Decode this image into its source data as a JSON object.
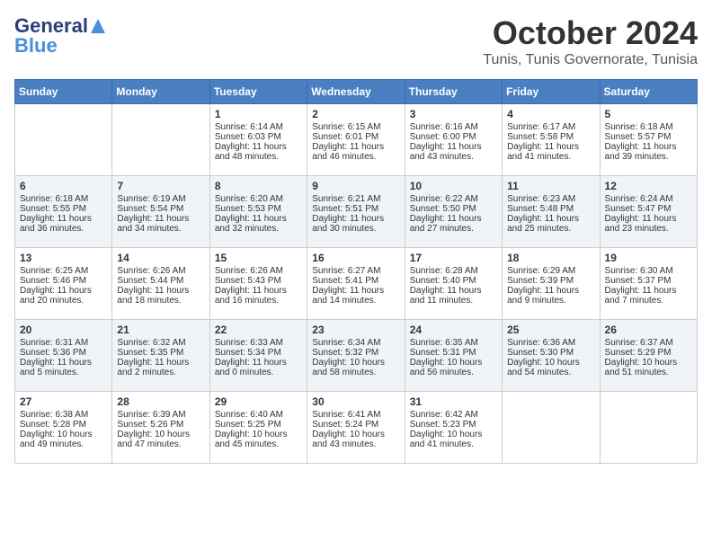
{
  "header": {
    "logo_line1": "General",
    "logo_line2": "Blue",
    "month": "October 2024",
    "location": "Tunis, Tunis Governorate, Tunisia"
  },
  "days_of_week": [
    "Sunday",
    "Monday",
    "Tuesday",
    "Wednesday",
    "Thursday",
    "Friday",
    "Saturday"
  ],
  "weeks": [
    [
      {
        "day": "",
        "sunrise": "",
        "sunset": "",
        "daylight": ""
      },
      {
        "day": "",
        "sunrise": "",
        "sunset": "",
        "daylight": ""
      },
      {
        "day": "1",
        "sunrise": "Sunrise: 6:14 AM",
        "sunset": "Sunset: 6:03 PM",
        "daylight": "Daylight: 11 hours and 48 minutes."
      },
      {
        "day": "2",
        "sunrise": "Sunrise: 6:15 AM",
        "sunset": "Sunset: 6:01 PM",
        "daylight": "Daylight: 11 hours and 46 minutes."
      },
      {
        "day": "3",
        "sunrise": "Sunrise: 6:16 AM",
        "sunset": "Sunset: 6:00 PM",
        "daylight": "Daylight: 11 hours and 43 minutes."
      },
      {
        "day": "4",
        "sunrise": "Sunrise: 6:17 AM",
        "sunset": "Sunset: 5:58 PM",
        "daylight": "Daylight: 11 hours and 41 minutes."
      },
      {
        "day": "5",
        "sunrise": "Sunrise: 6:18 AM",
        "sunset": "Sunset: 5:57 PM",
        "daylight": "Daylight: 11 hours and 39 minutes."
      }
    ],
    [
      {
        "day": "6",
        "sunrise": "Sunrise: 6:18 AM",
        "sunset": "Sunset: 5:55 PM",
        "daylight": "Daylight: 11 hours and 36 minutes."
      },
      {
        "day": "7",
        "sunrise": "Sunrise: 6:19 AM",
        "sunset": "Sunset: 5:54 PM",
        "daylight": "Daylight: 11 hours and 34 minutes."
      },
      {
        "day": "8",
        "sunrise": "Sunrise: 6:20 AM",
        "sunset": "Sunset: 5:53 PM",
        "daylight": "Daylight: 11 hours and 32 minutes."
      },
      {
        "day": "9",
        "sunrise": "Sunrise: 6:21 AM",
        "sunset": "Sunset: 5:51 PM",
        "daylight": "Daylight: 11 hours and 30 minutes."
      },
      {
        "day": "10",
        "sunrise": "Sunrise: 6:22 AM",
        "sunset": "Sunset: 5:50 PM",
        "daylight": "Daylight: 11 hours and 27 minutes."
      },
      {
        "day": "11",
        "sunrise": "Sunrise: 6:23 AM",
        "sunset": "Sunset: 5:48 PM",
        "daylight": "Daylight: 11 hours and 25 minutes."
      },
      {
        "day": "12",
        "sunrise": "Sunrise: 6:24 AM",
        "sunset": "Sunset: 5:47 PM",
        "daylight": "Daylight: 11 hours and 23 minutes."
      }
    ],
    [
      {
        "day": "13",
        "sunrise": "Sunrise: 6:25 AM",
        "sunset": "Sunset: 5:46 PM",
        "daylight": "Daylight: 11 hours and 20 minutes."
      },
      {
        "day": "14",
        "sunrise": "Sunrise: 6:26 AM",
        "sunset": "Sunset: 5:44 PM",
        "daylight": "Daylight: 11 hours and 18 minutes."
      },
      {
        "day": "15",
        "sunrise": "Sunrise: 6:26 AM",
        "sunset": "Sunset: 5:43 PM",
        "daylight": "Daylight: 11 hours and 16 minutes."
      },
      {
        "day": "16",
        "sunrise": "Sunrise: 6:27 AM",
        "sunset": "Sunset: 5:41 PM",
        "daylight": "Daylight: 11 hours and 14 minutes."
      },
      {
        "day": "17",
        "sunrise": "Sunrise: 6:28 AM",
        "sunset": "Sunset: 5:40 PM",
        "daylight": "Daylight: 11 hours and 11 minutes."
      },
      {
        "day": "18",
        "sunrise": "Sunrise: 6:29 AM",
        "sunset": "Sunset: 5:39 PM",
        "daylight": "Daylight: 11 hours and 9 minutes."
      },
      {
        "day": "19",
        "sunrise": "Sunrise: 6:30 AM",
        "sunset": "Sunset: 5:37 PM",
        "daylight": "Daylight: 11 hours and 7 minutes."
      }
    ],
    [
      {
        "day": "20",
        "sunrise": "Sunrise: 6:31 AM",
        "sunset": "Sunset: 5:36 PM",
        "daylight": "Daylight: 11 hours and 5 minutes."
      },
      {
        "day": "21",
        "sunrise": "Sunrise: 6:32 AM",
        "sunset": "Sunset: 5:35 PM",
        "daylight": "Daylight: 11 hours and 2 minutes."
      },
      {
        "day": "22",
        "sunrise": "Sunrise: 6:33 AM",
        "sunset": "Sunset: 5:34 PM",
        "daylight": "Daylight: 11 hours and 0 minutes."
      },
      {
        "day": "23",
        "sunrise": "Sunrise: 6:34 AM",
        "sunset": "Sunset: 5:32 PM",
        "daylight": "Daylight: 10 hours and 58 minutes."
      },
      {
        "day": "24",
        "sunrise": "Sunrise: 6:35 AM",
        "sunset": "Sunset: 5:31 PM",
        "daylight": "Daylight: 10 hours and 56 minutes."
      },
      {
        "day": "25",
        "sunrise": "Sunrise: 6:36 AM",
        "sunset": "Sunset: 5:30 PM",
        "daylight": "Daylight: 10 hours and 54 minutes."
      },
      {
        "day": "26",
        "sunrise": "Sunrise: 6:37 AM",
        "sunset": "Sunset: 5:29 PM",
        "daylight": "Daylight: 10 hours and 51 minutes."
      }
    ],
    [
      {
        "day": "27",
        "sunrise": "Sunrise: 6:38 AM",
        "sunset": "Sunset: 5:28 PM",
        "daylight": "Daylight: 10 hours and 49 minutes."
      },
      {
        "day": "28",
        "sunrise": "Sunrise: 6:39 AM",
        "sunset": "Sunset: 5:26 PM",
        "daylight": "Daylight: 10 hours and 47 minutes."
      },
      {
        "day": "29",
        "sunrise": "Sunrise: 6:40 AM",
        "sunset": "Sunset: 5:25 PM",
        "daylight": "Daylight: 10 hours and 45 minutes."
      },
      {
        "day": "30",
        "sunrise": "Sunrise: 6:41 AM",
        "sunset": "Sunset: 5:24 PM",
        "daylight": "Daylight: 10 hours and 43 minutes."
      },
      {
        "day": "31",
        "sunrise": "Sunrise: 6:42 AM",
        "sunset": "Sunset: 5:23 PM",
        "daylight": "Daylight: 10 hours and 41 minutes."
      },
      {
        "day": "",
        "sunrise": "",
        "sunset": "",
        "daylight": ""
      },
      {
        "day": "",
        "sunrise": "",
        "sunset": "",
        "daylight": ""
      }
    ]
  ]
}
